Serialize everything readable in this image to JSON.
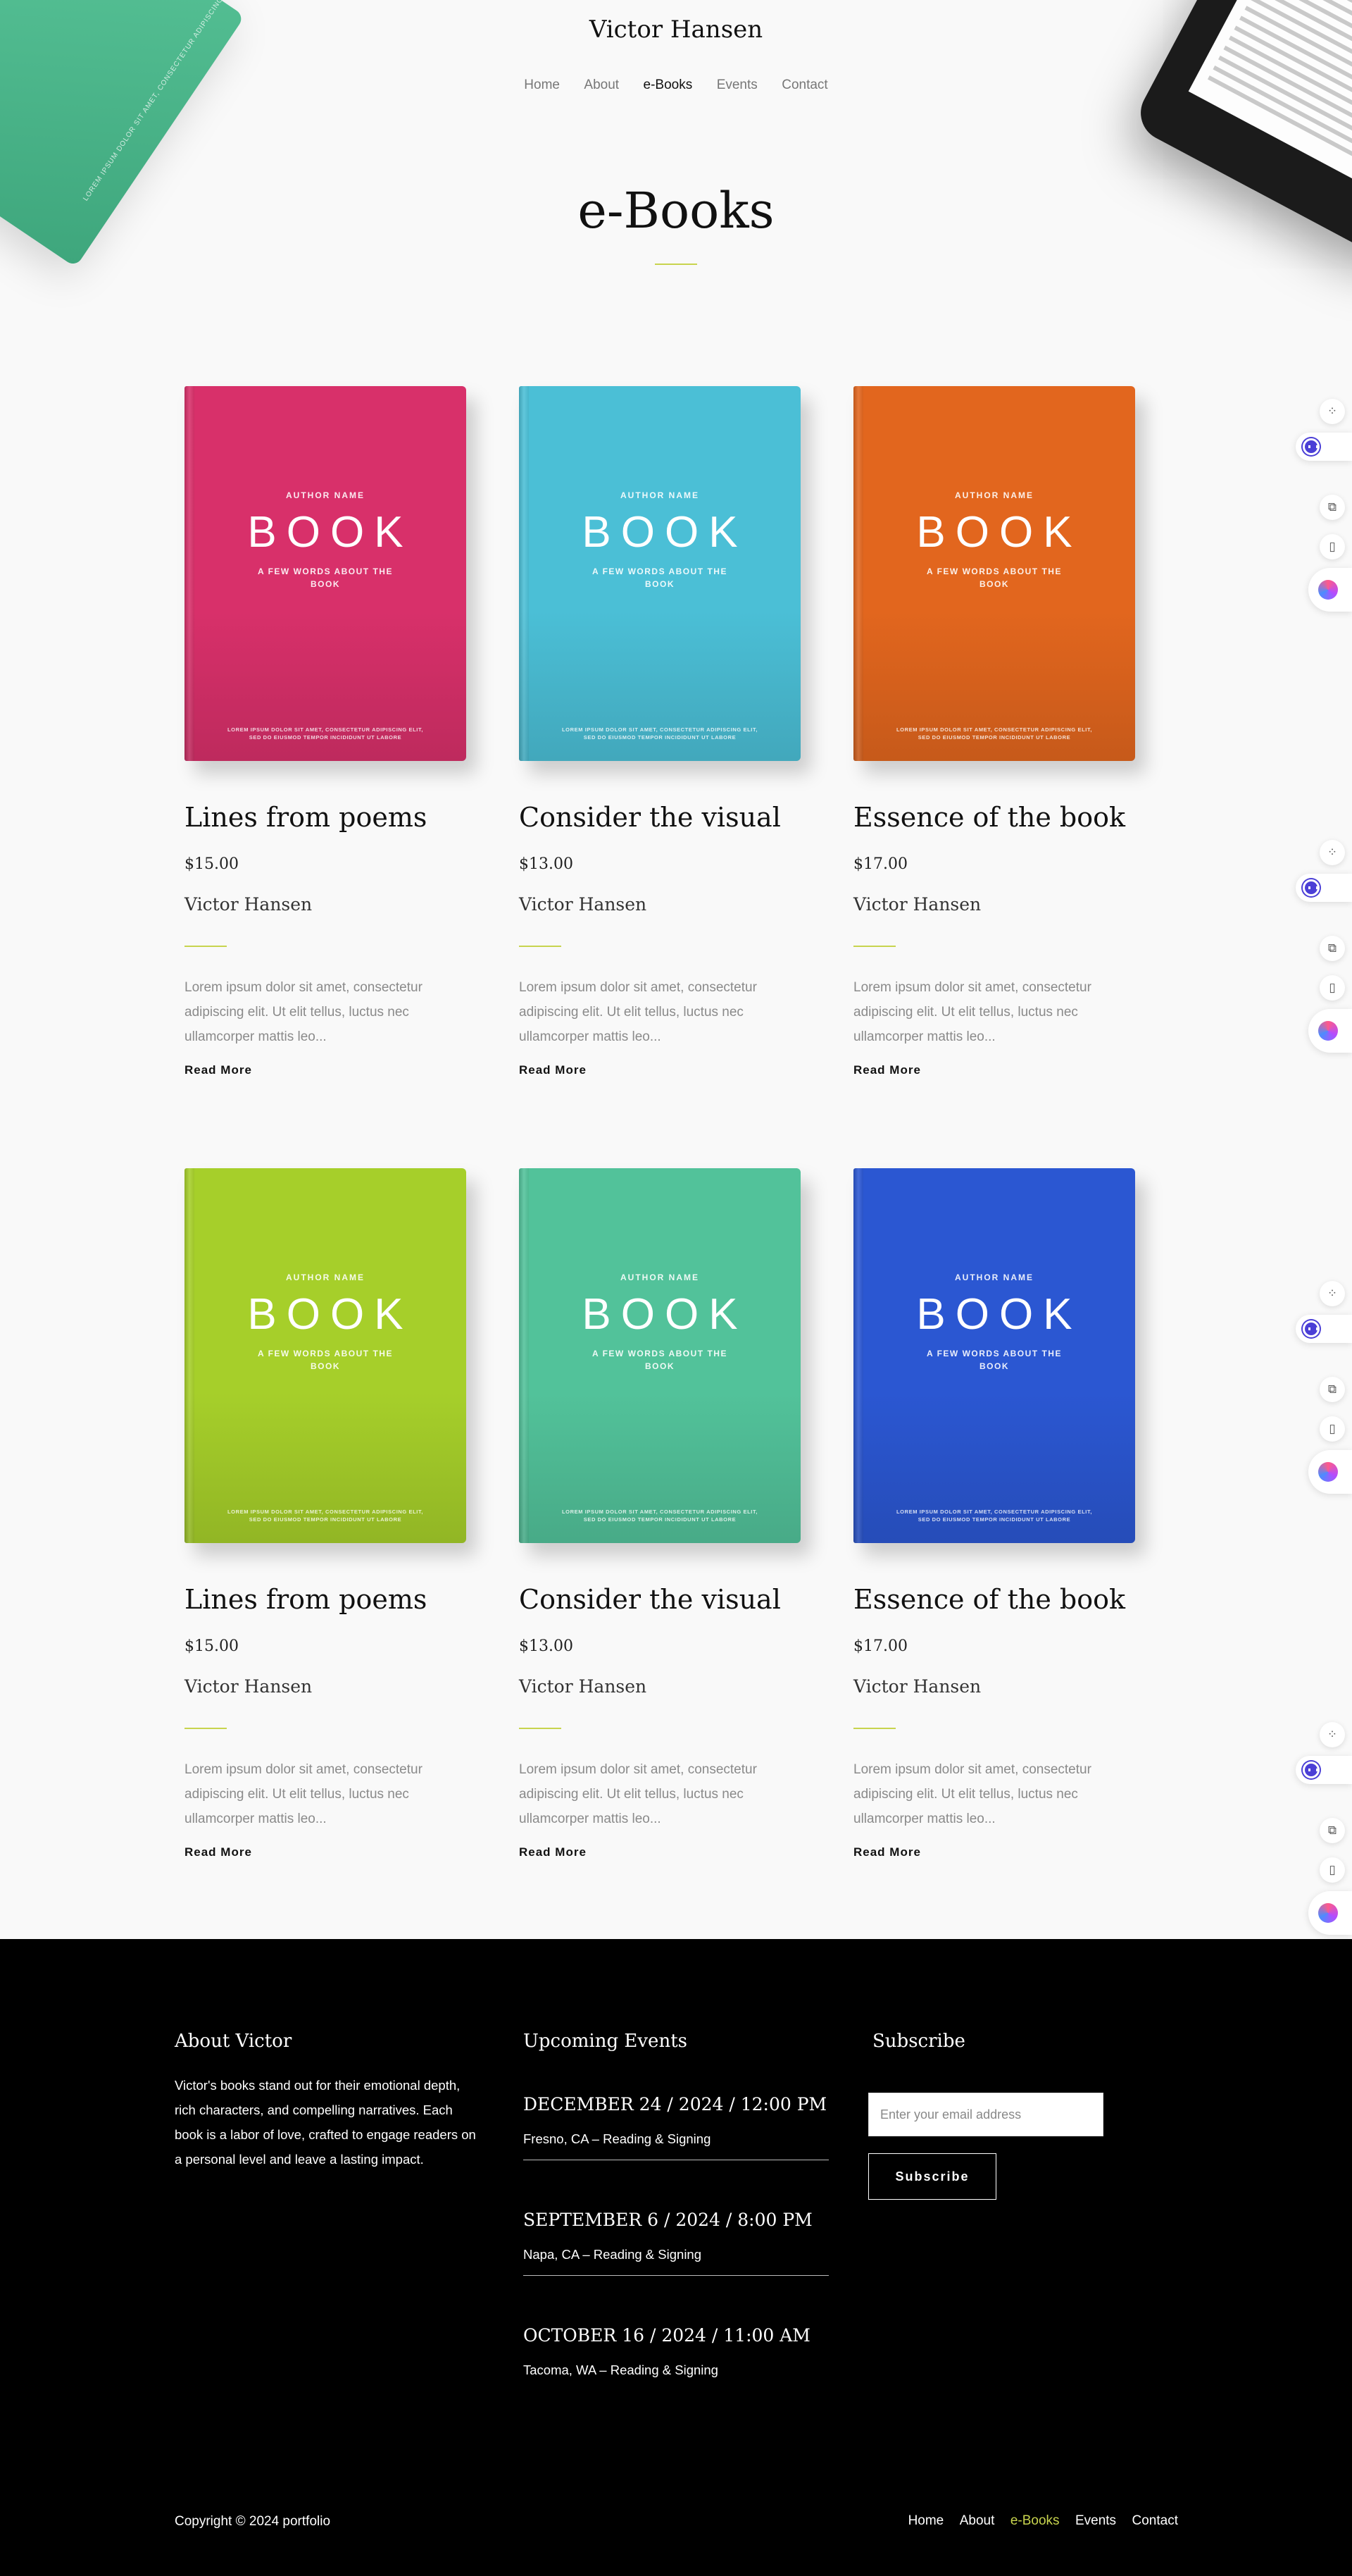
{
  "header": {
    "site_title": "Victor Hansen",
    "nav": [
      "Home",
      "About",
      "e-Books",
      "Events",
      "Contact"
    ],
    "active_nav": "e-Books"
  },
  "page_title": "e-Books",
  "cover_text": {
    "author": "AUTHOR NAME",
    "title": "BOOK",
    "subtitle": "A FEW WORDS ABOUT THE BOOK",
    "lorem": "LOREM IPSUM DOLOR SIT AMET, CONSECTETUR ADIPISCING ELIT, SED DO EIUSMOD TEMPOR INCIDIDUNT UT LABORE"
  },
  "books": [
    {
      "name": "Lines from poems",
      "price": "$15.00",
      "author": "Victor Hansen",
      "desc": "Lorem ipsum dolor sit amet, consectetur adipiscing elit. Ut elit tellus, luctus nec ullamcorper mattis leo...",
      "more": "Read More",
      "color": "#d8306a"
    },
    {
      "name": "Consider the visual",
      "price": "$13.00",
      "author": "Victor Hansen",
      "desc": "Lorem ipsum dolor sit amet, consectetur adipiscing elit. Ut elit tellus, luctus nec ullamcorper mattis leo...",
      "more": "Read More",
      "color": "#4bbfd6"
    },
    {
      "name": "Essence of the book",
      "price": "$17.00",
      "author": "Victor Hansen",
      "desc": "Lorem ipsum dolor sit amet, consectetur adipiscing elit. Ut elit tellus, luctus nec ullamcorper mattis leo...",
      "more": "Read More",
      "color": "#e2661e"
    },
    {
      "name": "Lines from poems",
      "price": "$15.00",
      "author": "Victor Hansen",
      "desc": "Lorem ipsum dolor sit amet, consectetur adipiscing elit. Ut elit tellus, luctus nec ullamcorper mattis leo...",
      "more": "Read More",
      "color": "#a6cf2a"
    },
    {
      "name": "Consider the visual",
      "price": "$13.00",
      "author": "Victor Hansen",
      "desc": "Lorem ipsum dolor sit amet, consectetur adipiscing elit. Ut elit tellus, luctus nec ullamcorper mattis leo...",
      "more": "Read More",
      "color": "#52c29a"
    },
    {
      "name": "Essence of the book",
      "price": "$17.00",
      "author": "Victor Hansen",
      "desc": "Lorem ipsum dolor sit amet, consectetur adipiscing elit. Ut elit tellus, luctus nec ullamcorper mattis leo...",
      "more": "Read More",
      "color": "#2b57d2"
    }
  ],
  "footer": {
    "about_heading": "About Victor",
    "about_text": "Victor's books stand out for their emotional depth, rich characters, and compelling narratives. Each book is a labor of love, crafted to engage readers on a personal level and leave a lasting impact.",
    "events_heading": "Upcoming Events",
    "events": [
      {
        "date": "DECEMBER 24 / 2024 / 12:00 PM",
        "place": "Fresno, CA – Reading & Signing"
      },
      {
        "date": "SEPTEMBER 6 / 2024 / 8:00 PM",
        "place": "Napa, CA – Reading & Signing"
      },
      {
        "date": "OCTOBER 16 / 2024 / 11:00 AM",
        "place": "Tacoma, WA – Reading & Signing"
      }
    ],
    "subscribe_heading": "Subscribe",
    "email_placeholder": "Enter your email address",
    "subscribe_button": "Subscribe",
    "copyright": "Copyright © 2024 portfolio",
    "nav": [
      "Home",
      "About",
      "e-Books",
      "Events",
      "Contact"
    ],
    "active_nav": "e-Books"
  },
  "accent_color": "#c8d44e"
}
